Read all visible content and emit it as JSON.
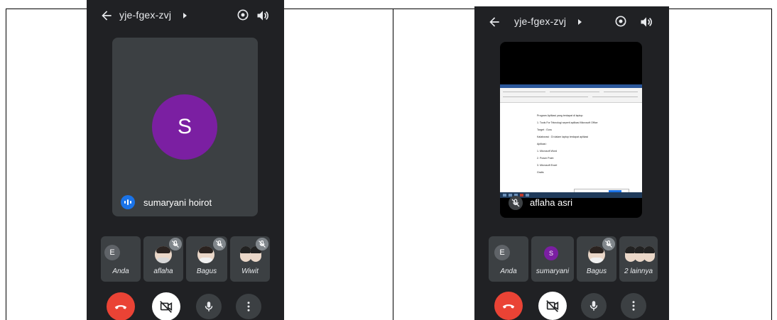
{
  "colors": {
    "app_bg": "#202124",
    "tile_bg": "#3c4043",
    "end_call": "#ea4335",
    "avatar_purple": "#7b1fa2",
    "avatar_gray": "#5f6368",
    "speaking_blue": "#1a73e8"
  },
  "left_screen": {
    "meeting_code": "yje-fgex-zvj",
    "main_tile": {
      "avatar_letter": "S",
      "name": "sumaryani hoirot",
      "status_icon": "speaking-icon"
    },
    "participants": [
      {
        "name": "Anda",
        "avatar_letter": "E"
      },
      {
        "name": "aflaha",
        "muted": true
      },
      {
        "name": "Bagus",
        "muted": true
      },
      {
        "name": "Wiwit",
        "muted": true
      }
    ]
  },
  "right_screen": {
    "meeting_code": "yje-fgex-zvj",
    "main_tile": {
      "name": "aflaha asri",
      "status_icon": "mic-off-icon",
      "shared_document_lines": [
        "Program Aplikasi yang terdapat di laptop",
        "1. Tools For Teknologi seperti aplikasi Microsoft Office",
        "Target : Guru",
        "Kalaborasi : Di dalam laptop terdapat aplikasi",
        "Aplikasi :",
        "1. Microsoft Word",
        "2. Power Point",
        "3. Microsoft Excel",
        "Gratis"
      ]
    },
    "participants": [
      {
        "name": "Anda",
        "avatar_letter": "E"
      },
      {
        "name": "sumaryani",
        "avatar_letter": "S"
      },
      {
        "name": "Bagus",
        "muted": true
      },
      {
        "name": "2 lainnya",
        "muted": false
      }
    ]
  }
}
